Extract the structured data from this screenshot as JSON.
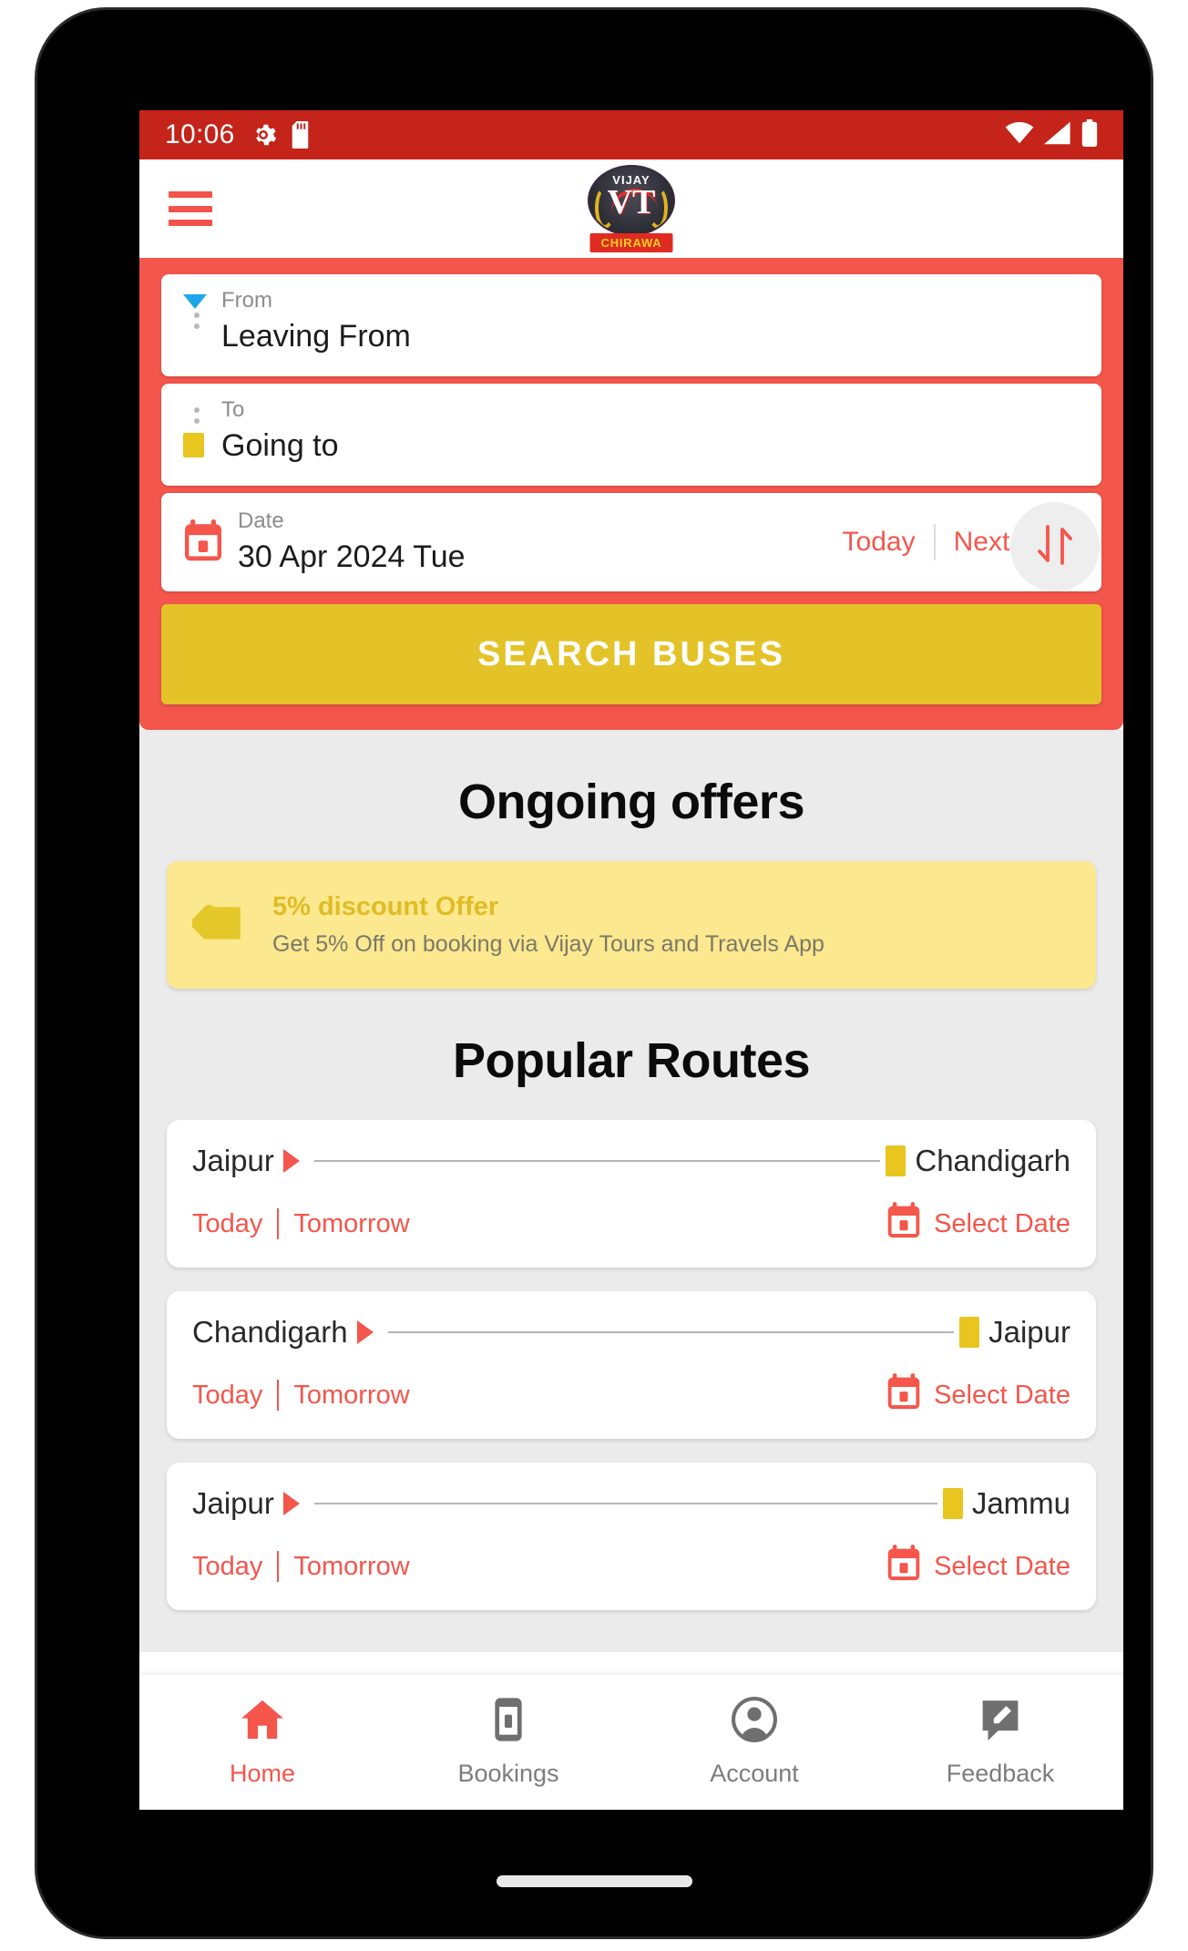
{
  "status_bar": {
    "time": "10:06",
    "left_icons": [
      "gear-icon",
      "sd-card-icon"
    ],
    "right_icons": [
      "wifi-icon",
      "signal-icon",
      "battery-icon"
    ],
    "background_color": "#C4241A"
  },
  "header": {
    "menu_icon": "hamburger-menu-icon",
    "logo": {
      "top_text": "VIJAY",
      "monogram": "VT",
      "banner_text": "CHIRAWA"
    }
  },
  "search_panel": {
    "accent_color": "#F4564C",
    "from": {
      "label": "From",
      "value": "Leaving From",
      "icon": "location-pin-down-icon"
    },
    "to": {
      "label": "To",
      "value": "Going to",
      "icon": "destination-square-icon"
    },
    "swap_button_icon": "swap-vertical-icon",
    "date": {
      "label": "Date",
      "value": "30 Apr 2024 Tue",
      "icon": "calendar-icon",
      "today_label": "Today",
      "next_day_label": "Next day"
    },
    "search_button_label": "SEARCH BUSES",
    "search_button_color": "#E4C328"
  },
  "offers": {
    "title": "Ongoing offers",
    "card": {
      "icon": "tag-icon",
      "title": "5% discount Offer",
      "subtitle": "Get 5% Off on booking via Vijay Tours and Travels App",
      "background_color": "#FBE88F",
      "title_color": "#E0BC25"
    }
  },
  "popular_routes": {
    "title": "Popular Routes",
    "today_label": "Today",
    "tomorrow_label": "Tomorrow",
    "select_date_label": "Select Date",
    "routes": [
      {
        "origin": "Jaipur",
        "destination": "Chandigarh"
      },
      {
        "origin": "Chandigarh",
        "destination": "Jaipur"
      },
      {
        "origin": "Jaipur",
        "destination": "Jammu"
      }
    ]
  },
  "fab": {
    "icon": "chevron-right-icon",
    "color": "#F4564C"
  },
  "bottom_nav": {
    "items": [
      {
        "label": "Home",
        "icon": "home-icon",
        "active": true
      },
      {
        "label": "Bookings",
        "icon": "ticket-icon",
        "active": false
      },
      {
        "label": "Account",
        "icon": "account-circle-icon",
        "active": false
      },
      {
        "label": "Feedback",
        "icon": "feedback-icon",
        "active": false
      }
    ],
    "active_color": "#F4564C",
    "inactive_color": "#7D7D7D"
  }
}
